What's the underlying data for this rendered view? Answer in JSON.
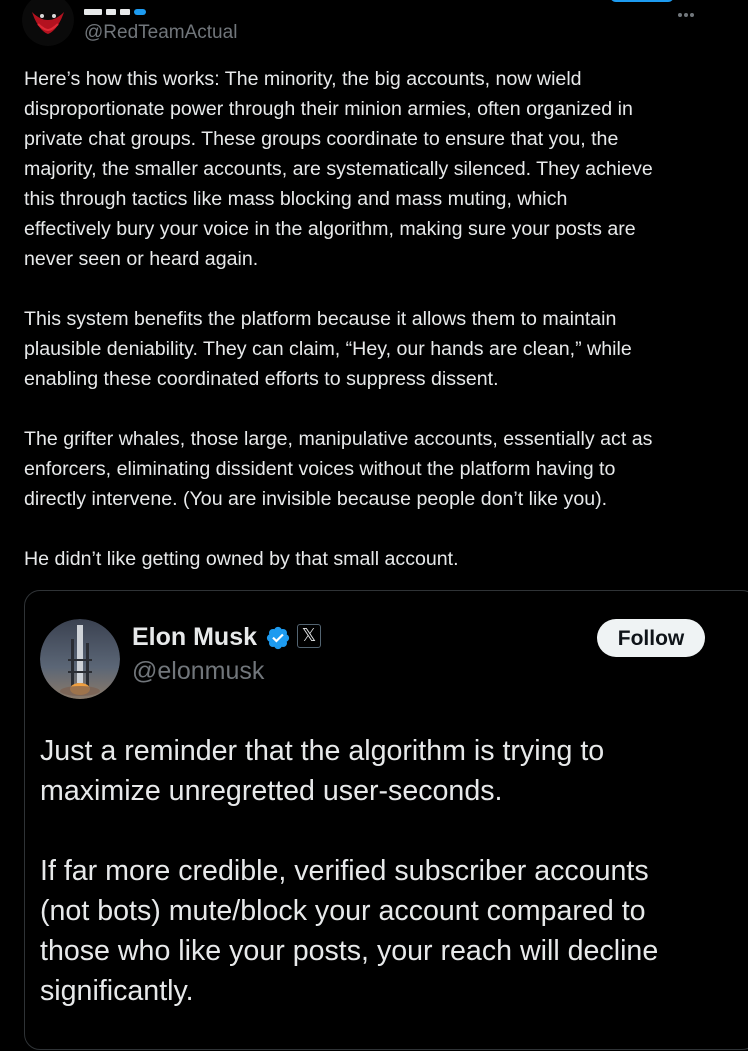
{
  "post": {
    "handle": "@RedTeamActual",
    "paragraphs": [
      "Here’s how this works: The minority, the big accounts, now wield\ndisproportionate power through their minion armies, often organized in\nprivate chat groups. These groups coordinate to ensure that you, the\nmajority, the smaller accounts, are systematically silenced. They achieve\nthis through tactics like mass blocking and mass muting, which\neffectively bury your voice in the algorithm, making sure your posts are\nnever seen or heard again.",
      "This system benefits the platform because it allows them to maintain\nplausible deniability. They can claim, “Hey, our hands are clean,” while\nenabling these coordinated efforts to suppress dissent.",
      "The grifter whales, those large, manipulative accounts, essentially act as\nenforcers, eliminating dissident voices without the platform having to\ndirectly intervene. (You are invisible because people don’t like you).",
      "He didn’t like getting owned by that small account."
    ]
  },
  "quoted_post": {
    "name": "Elon Musk",
    "handle": "@elonmusk",
    "badge_glyph": "𝕏",
    "follow_label": "Follow",
    "paragraphs": [
      "Just a reminder that the algorithm is trying to\nmaximize unregretted user-seconds.",
      "If far more credible, verified subscriber accounts\n(not bots) mute/block your account compared to\nthose who like your posts, your reach will decline\nsignificantly."
    ]
  },
  "colors": {
    "background": "#000000",
    "text": "#e7e9ea",
    "secondary": "#71767b",
    "verified": "#1d9bf0",
    "border": "#2f3336"
  },
  "icons": {
    "verified": "verified-badge-icon",
    "x_logo": "x-logo-icon",
    "more": "more-icon"
  }
}
